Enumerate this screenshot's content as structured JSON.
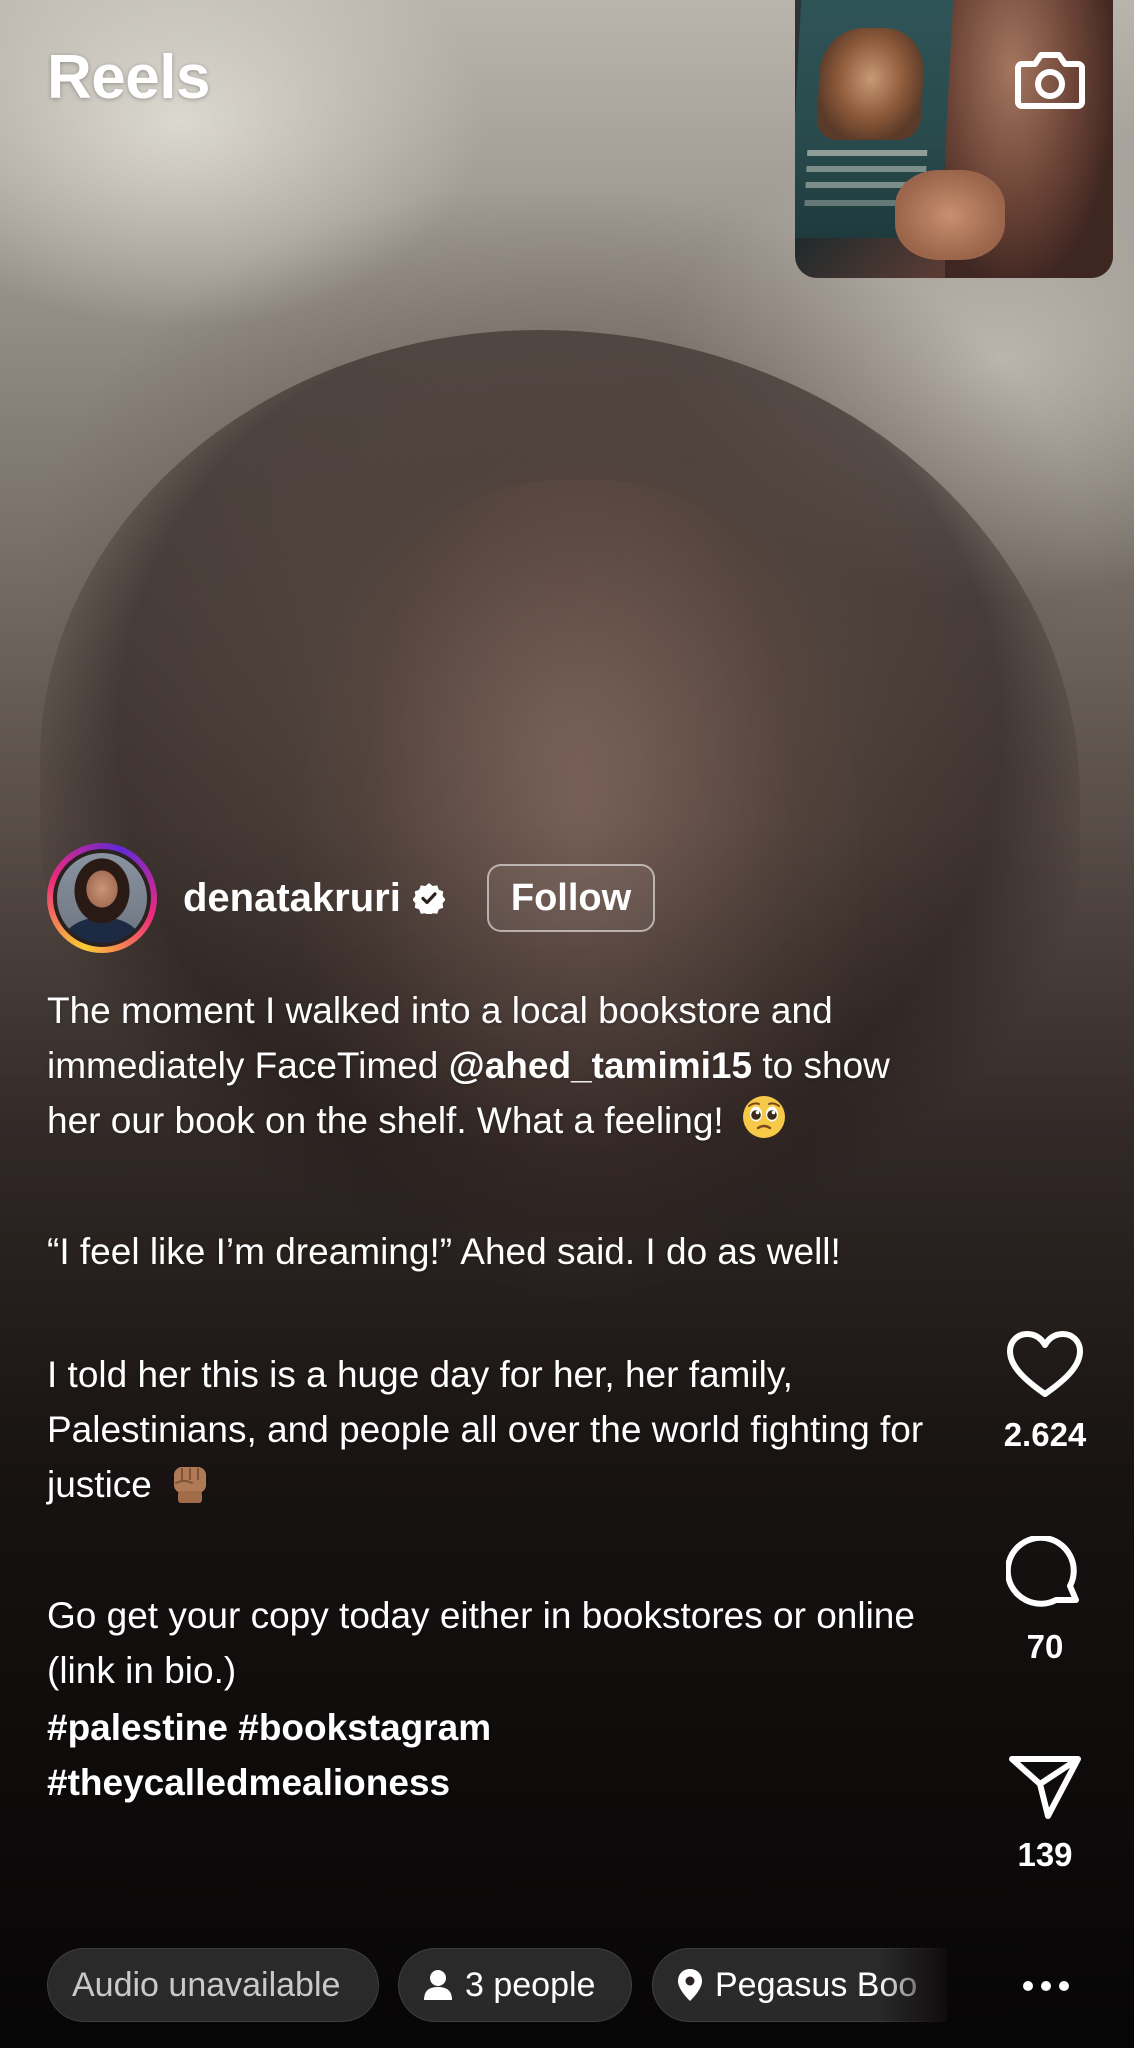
{
  "header": {
    "title": "Reels"
  },
  "post": {
    "username": "denatakruri",
    "verified": true,
    "follow_label": "Follow",
    "caption": {
      "p1_before": "The moment I walked into a local bookstore and immediately FaceTimed ",
      "p1_mention": "@ahed_tamimi15",
      "p1_after": " to show her our book on the shelf. What a feeling!",
      "p1_emoji": "🥹",
      "p2": "“I feel like I’m dreaming!” Ahed said. I do as well!",
      "p3": "I told her this is a huge day for her, her family, Palestinians, and people all over the world fighting for justice",
      "p3_emoji": "✊🏽",
      "p4": "Go get your copy today either in bookstores or online (link in bio.)",
      "tags_line1": "#palestine #bookstagram",
      "tags_line2": "#theycalledmealioness"
    }
  },
  "actions": {
    "likes": "2.624",
    "comments": "70",
    "shares": "139"
  },
  "chips": {
    "audio": "Audio unavailable",
    "people": "3 people",
    "location": "Pegasus Boo"
  },
  "icons": {
    "camera": "camera-icon",
    "verified": "verified-badge-icon",
    "like": "heart-icon",
    "comment": "comment-bubble-icon",
    "share": "paper-plane-icon",
    "person": "person-icon",
    "location": "location-pin-icon",
    "more": "more-horizontal-icon"
  }
}
